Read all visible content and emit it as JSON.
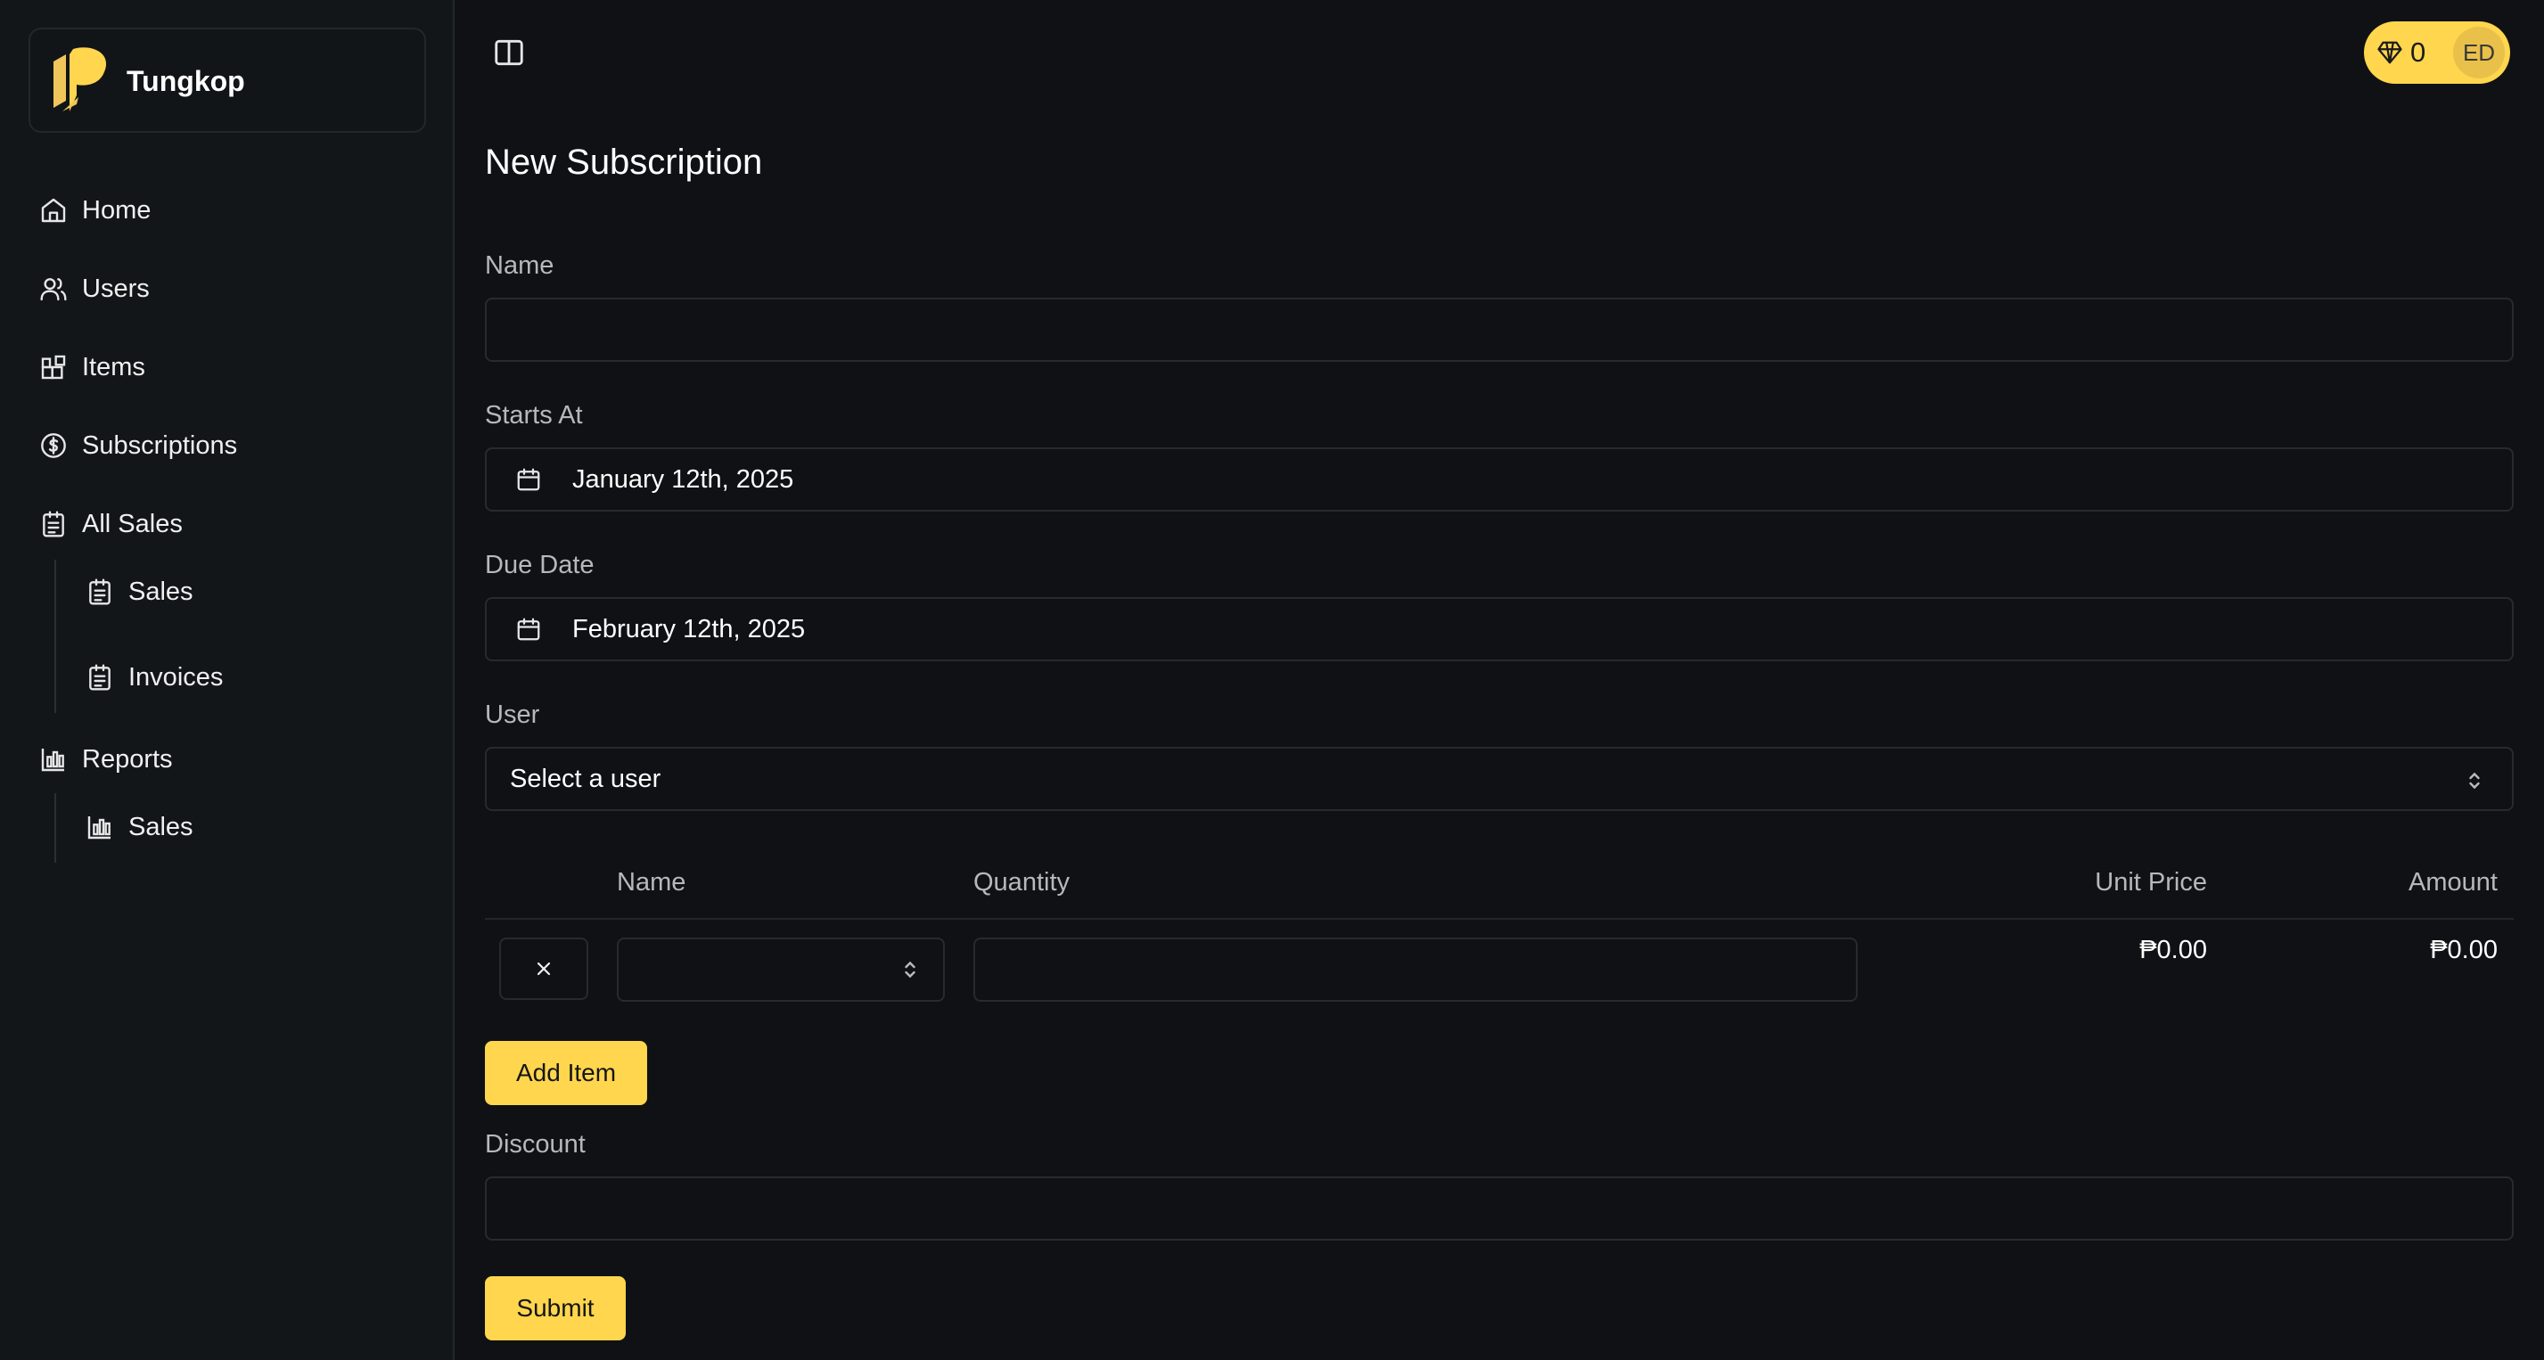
{
  "brand": {
    "name": "Tungkop"
  },
  "sidebar": {
    "items": [
      {
        "label": "Home",
        "icon": "home-icon"
      },
      {
        "label": "Users",
        "icon": "users-icon"
      },
      {
        "label": "Items",
        "icon": "items-icon"
      },
      {
        "label": "Subscriptions",
        "icon": "dollar-circle-icon"
      },
      {
        "label": "All Sales",
        "icon": "clipboard-icon",
        "children": [
          {
            "label": "Sales",
            "icon": "clipboard-icon"
          },
          {
            "label": "Invoices",
            "icon": "clipboard-icon"
          }
        ]
      },
      {
        "label": "Reports",
        "icon": "bar-chart-icon",
        "children": [
          {
            "label": "Sales",
            "icon": "bar-chart-icon"
          }
        ]
      }
    ]
  },
  "header": {
    "credits": "0",
    "avatar_initials": "ED"
  },
  "form": {
    "title": "New Subscription",
    "name_label": "Name",
    "name_value": "",
    "starts_at_label": "Starts At",
    "starts_at_value": "January 12th, 2025",
    "due_date_label": "Due Date",
    "due_date_value": "February 12th, 2025",
    "user_label": "User",
    "user_value": "Select a user",
    "discount_label": "Discount",
    "discount_value": "",
    "add_item_label": "Add Item",
    "submit_label": "Submit"
  },
  "items_table": {
    "columns": [
      "Name",
      "Quantity",
      "Unit Price",
      "Amount"
    ],
    "rows": [
      {
        "name": "",
        "quantity": "",
        "unit_price": "₱0.00",
        "amount": "₱0.00"
      }
    ]
  },
  "colors": {
    "accent": "#ffd64d",
    "background": "#0f1114",
    "sidebar": "#121619",
    "border": "#262b30"
  }
}
